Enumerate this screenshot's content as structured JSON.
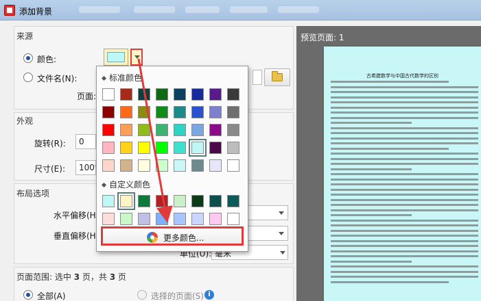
{
  "window": {
    "title": "添加背景"
  },
  "source": {
    "title": "来源",
    "color_label": "颜色:",
    "file_label": "文件名(N):",
    "page_label": "页面:",
    "current_color": "#bff7f7"
  },
  "appearance": {
    "title": "外观",
    "rotation_label": "旋转(R):",
    "rotation_value": "0",
    "size_label": "尺寸(E):",
    "size_value": "100%"
  },
  "layout": {
    "title": "布局选项",
    "h_offset_label": "水平偏移(H",
    "v_offset_label": "垂直偏移(H",
    "unit_label": "单位(U):",
    "unit_value": "毫米"
  },
  "page_range": {
    "title_prefix": "页面范围: 选中 ",
    "selected": "3",
    "title_mid": " 页，共 ",
    "total": "3",
    "title_suffix": " 页",
    "all_label": "全部(A)",
    "selected_label": "选择的页面(S)"
  },
  "preview": {
    "title": "预览页面: 1",
    "page_background": "#c9f7f7",
    "page_heading": "古希腊数学与中国古代数学的区别"
  },
  "color_popup": {
    "standard_title": "标准颜色",
    "custom_title": "自定义颜色",
    "more_label": "更多颜色...",
    "standard_colors": [
      [
        "#ffffff",
        "#a52a1a",
        "#0e3f3f",
        "#0f6a16",
        "#0d3f60",
        "#182a9c",
        "#5a1a8c",
        "#3a3a3a"
      ],
      [
        "#8b0000",
        "#ff6a1a",
        "#8b8b14",
        "#118b1a",
        "#1a8a8a",
        "#2a52cc",
        "#7f7fcf",
        "#6f6f6f"
      ],
      [
        "#ff0000",
        "#ff9f57",
        "#8fbc1a",
        "#3cb371",
        "#2fd3c3",
        "#7aa7e0",
        "#8a0a8a",
        "#8a8a8a"
      ],
      [
        "#ffb6c1",
        "#ffd21a",
        "#ffff00",
        "#00ff00",
        "#40e0d0",
        "#bff7f7",
        "#4a0a4a",
        "#bdbdbd"
      ],
      [
        "#ffd6cc",
        "#d2b48c",
        "#ffffe0",
        "#ccffcc",
        "#c9f7f7",
        "#6f8a8f",
        "#e6e6fa",
        "#ffffff"
      ]
    ],
    "custom_colors": [
      [
        "#bff7f7",
        "#fdf3c4",
        "#0e7a3a",
        "#b22222",
        "#c9f0c9",
        "#0b3a1a",
        "#0d4f4f",
        "#0d5a5a"
      ],
      [
        "#ffdddd",
        "#c9f7c9",
        "#c0c0e6",
        "#7fb0ff",
        "#a9c4ff",
        "#c9d6ff",
        "#ffc9f2",
        "#ffffff"
      ]
    ]
  }
}
